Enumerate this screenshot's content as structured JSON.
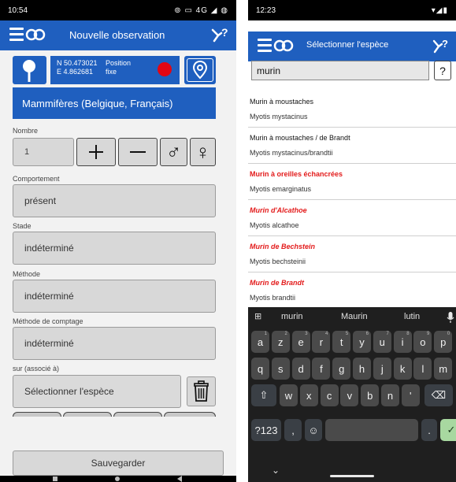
{
  "left": {
    "status": {
      "time": "10:54",
      "icons": "⊚ ▭ 4G ◢ ◍"
    },
    "appbar": {
      "title": "Nouvelle observation"
    },
    "gps": {
      "coord_n": "N 50.473021",
      "coord_e": "E 4.862681",
      "fix_line1": "Position",
      "fix_line2": "fixe"
    },
    "group_button": "Mammifères (Belgique, Français)",
    "nombre": {
      "label": "Nombre",
      "value": "1",
      "plus": "+",
      "minus": "—",
      "male": "♂",
      "female": "♀"
    },
    "comportement": {
      "label": "Comportement",
      "value": "présent"
    },
    "stade": {
      "label": "Stade",
      "value": "indéterminé"
    },
    "methode": {
      "label": "Méthode",
      "value": "indéterminé"
    },
    "methode_comptage": {
      "label": "Méthode de comptage",
      "value": "indéterminé"
    },
    "associe": {
      "label": "sur (associé à)",
      "placeholder": "Sélectionner l'espèce"
    },
    "save": "Sauvegarder"
  },
  "right": {
    "status": {
      "time": "12:23",
      "icons": "▾◢▮"
    },
    "appbar": {
      "title": "Sélectionner l'espèce"
    },
    "search": {
      "value": "murin",
      "help": "?"
    },
    "results": [
      {
        "fr": "Murin à moustaches",
        "sci": "Myotis mystacinus",
        "red": false
      },
      {
        "fr": "Murin à moustaches / de Brandt",
        "sci": "Myotis mystacinus/brandtii",
        "red": false
      },
      {
        "fr": "Murin à oreilles échancrées",
        "sci": "Myotis emarginatus",
        "red": true
      },
      {
        "fr": "Murin d'Alcathoe",
        "sci": "Myotis alcathoe",
        "red": true
      },
      {
        "fr": "Murin de Bechstein",
        "sci": "Myotis bechsteinii",
        "red": true
      },
      {
        "fr": "Murin de Brandt",
        "sci": "Myotis brandtii",
        "red": true
      }
    ],
    "keyboard": {
      "suggestions": [
        "murin",
        "Maurin",
        "lutin"
      ],
      "row1": [
        "a",
        "z",
        "e",
        "r",
        "t",
        "y",
        "u",
        "i",
        "o",
        "p"
      ],
      "row1_hints": [
        "1",
        "2",
        "3",
        "4",
        "5",
        "6",
        "7",
        "8",
        "9",
        "0"
      ],
      "row2": [
        "q",
        "s",
        "d",
        "f",
        "g",
        "h",
        "j",
        "k",
        "l",
        "m"
      ],
      "row3": [
        "w",
        "x",
        "c",
        "v",
        "b",
        "n",
        "'"
      ],
      "symbols": "?123",
      "comma": ",",
      "period": ".",
      "emoji": "☺",
      "shift": "⇧",
      "backspace": "⌫",
      "enter": "✓",
      "chevron": "⌄"
    }
  },
  "colors": {
    "brand_blue": "#1f5fbf",
    "alert_red": "#e30613",
    "keyboard_bg": "#1f1f1f"
  }
}
